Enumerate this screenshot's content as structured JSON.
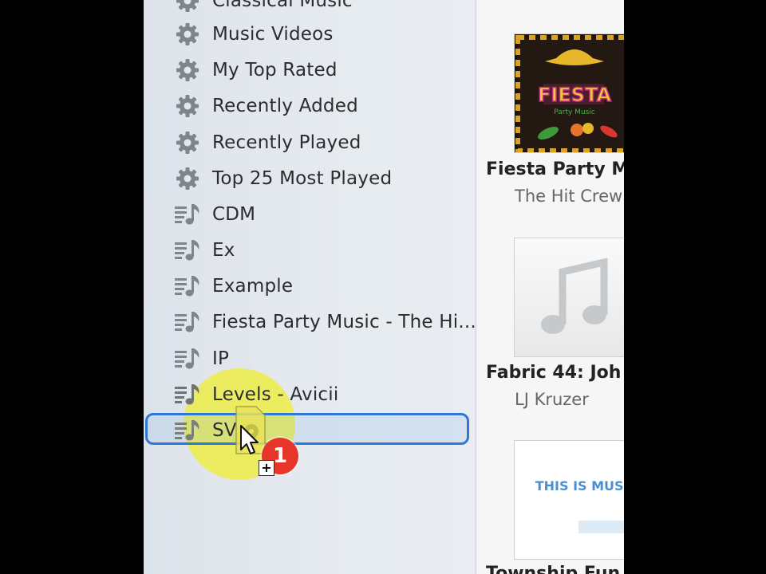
{
  "sidebar": {
    "items": [
      {
        "label": "Classical Music",
        "icon": "gear-icon"
      },
      {
        "label": "Music Videos",
        "icon": "gear-icon"
      },
      {
        "label": "My Top Rated",
        "icon": "gear-icon"
      },
      {
        "label": "Recently Added",
        "icon": "gear-icon"
      },
      {
        "label": "Recently Played",
        "icon": "gear-icon"
      },
      {
        "label": "Top 25 Most Played",
        "icon": "gear-icon"
      },
      {
        "label": "CDM",
        "icon": "playlist-icon"
      },
      {
        "label": "Ex",
        "icon": "playlist-icon"
      },
      {
        "label": "Example",
        "icon": "playlist-icon"
      },
      {
        "label": "Fiesta Party Music - The Hi...",
        "icon": "playlist-icon"
      },
      {
        "label": "IP",
        "icon": "playlist-icon"
      },
      {
        "label": "Levels - Avicii",
        "icon": "playlist-icon"
      },
      {
        "label": "SV",
        "icon": "playlist-icon"
      }
    ]
  },
  "drag": {
    "count": "1",
    "copy_symbol": "+"
  },
  "albums": [
    {
      "title": "Fiesta Party M",
      "artist": "The Hit Crew",
      "art_text": "FIESTA",
      "art_subtext": "Party Music"
    },
    {
      "title": "Fabric 44: Joh",
      "artist": "LJ Kruzer"
    },
    {
      "title": "Township Fun",
      "art_text": "THIS IS MUSIC"
    }
  ],
  "colors": {
    "accent": "#2f78d4",
    "badge": "#e8352a",
    "highlight": "#eeee28"
  }
}
